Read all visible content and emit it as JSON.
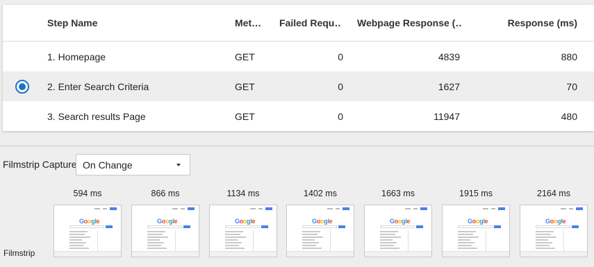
{
  "table": {
    "headers": {
      "step_name": "Step Name",
      "method": "Met…",
      "failed_requests": "Failed Requ…",
      "webpage_response": "Webpage Response (…",
      "response": "Response (ms)"
    },
    "rows": [
      {
        "step_name": "1. Homepage",
        "method": "GET",
        "failed_requests": "0",
        "webpage_response": "4839",
        "response": "880",
        "selected": false
      },
      {
        "step_name": "2. Enter Search Criteria",
        "method": "GET",
        "failed_requests": "0",
        "webpage_response": "1627",
        "response": "70",
        "selected": true
      },
      {
        "step_name": "3. Search results Page",
        "method": "GET",
        "failed_requests": "0",
        "webpage_response": "11947",
        "response": "480",
        "selected": false
      }
    ]
  },
  "filmstrip_capture": {
    "label": "Filmstrip Capture",
    "selected_option": "On Change"
  },
  "filmstrip": {
    "label": "Filmstrip",
    "frames": [
      {
        "time": "594 ms"
      },
      {
        "time": "866 ms"
      },
      {
        "time": "1134 ms"
      },
      {
        "time": "1402 ms"
      },
      {
        "time": "1663 ms"
      },
      {
        "time": "1915 ms"
      },
      {
        "time": "2164 ms"
      }
    ],
    "thumbnail_logo": "Google"
  },
  "colors": {
    "accent": "#1a73c8",
    "selected_row_bg": "#eeeeee",
    "page_bg": "#eeeeee"
  }
}
